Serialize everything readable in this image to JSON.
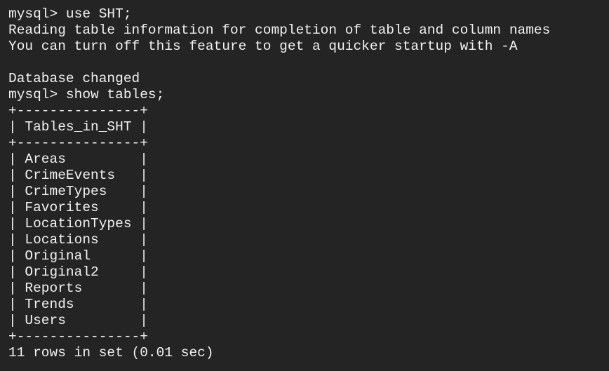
{
  "terminal": {
    "background": "#242424",
    "foreground": "#f2f2f2",
    "lines": [
      "mysql> use SHT;",
      "Reading table information for completion of table and column names",
      "You can turn off this feature to get a quicker startup with -A",
      "",
      "Database changed",
      "mysql> show tables;",
      "+---------------+",
      "| Tables_in_SHT |",
      "+---------------+",
      "| Areas         |",
      "| CrimeEvents   |",
      "| CrimeTypes    |",
      "| Favorites     |",
      "| LocationTypes |",
      "| Locations     |",
      "| Original      |",
      "| Original2     |",
      "| Reports       |",
      "| Trends        |",
      "| Users         |",
      "+---------------+",
      "11 rows in set (0.01 sec)"
    ]
  }
}
